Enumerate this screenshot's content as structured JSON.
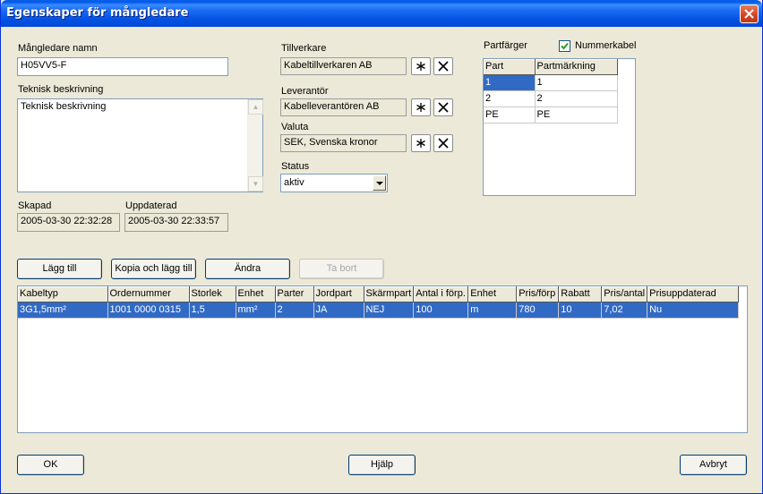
{
  "window": {
    "title": "Egenskaper för mångledare"
  },
  "form": {
    "name_label": "Mångledare namn",
    "name_value": "H05VV5-F",
    "tech_label": "Teknisk beskrivning",
    "tech_value": "Teknisk beskrivning",
    "created_label": "Skapad",
    "created_value": "2005-03-30 22:32:28",
    "updated_label": "Uppdaterad",
    "updated_value": "2005-03-30 22:33:57",
    "manufacturer_label": "Tillverkare",
    "manufacturer_value": "Kabeltillverkaren AB",
    "supplier_label": "Leverantör",
    "supplier_value": "Kabelleverantören AB",
    "currency_label": "Valuta",
    "currency_value": "SEK, Svenska kronor",
    "status_label": "Status",
    "status_value": "aktiv"
  },
  "parts": {
    "label": "Partfärger",
    "numbered_label": "Nummerkabel",
    "numbered_checked": true,
    "headers": [
      "Part",
      "Partmärkning"
    ],
    "rows": [
      [
        "1",
        "1"
      ],
      [
        "2",
        "2"
      ],
      [
        "PE",
        "PE"
      ]
    ]
  },
  "actions": {
    "add": "Lägg till",
    "copy_add": "Kopia och lägg till",
    "change": "Ändra",
    "delete": "Ta bort"
  },
  "cable_table": {
    "headers": [
      "Kabeltyp",
      "Ordernummer",
      "Storlek",
      "Enhet",
      "Parter",
      "Jordpart",
      "Skärmpart",
      "Antal i förp.",
      "Enhet",
      "Pris/förp",
      "Rabatt",
      "Pris/antal",
      "Prisuppdaterad"
    ],
    "rows": [
      [
        "3G1,5mm²",
        "1001 0000 0315",
        "1,5",
        "mm²",
        "2",
        "JA",
        "NEJ",
        "100",
        "m",
        "780",
        "10",
        "7,02",
        "Nu"
      ]
    ]
  },
  "footer": {
    "ok": "OK",
    "help": "Hjälp",
    "cancel": "Avbryt"
  },
  "icons": {
    "new": "asterisk-icon",
    "clear": "x-icon"
  },
  "colors": {
    "titlebar": "#0454E3",
    "selection": "#316AC5",
    "dialog": "#ECE9D8"
  }
}
